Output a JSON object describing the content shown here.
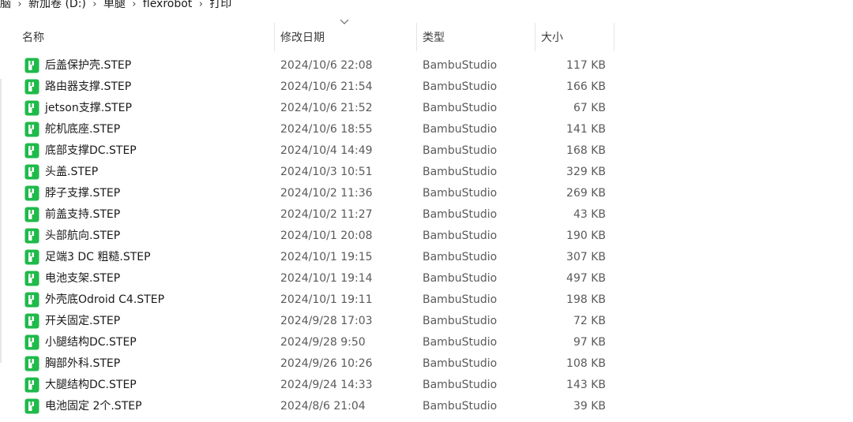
{
  "breadcrumb": {
    "segments": [
      "脑",
      "新加卷 (D:)",
      "单腿",
      "flexrobot",
      "打印"
    ],
    "separator": "›"
  },
  "columns": {
    "name": "名称",
    "modified": "修改日期",
    "type": "类型",
    "size": "大小"
  },
  "sort": {
    "column": "modified",
    "direction": "descending",
    "icon": "chevron-down-icon"
  },
  "file_icon": {
    "name": "bambu-step-file-icon",
    "color": "#1fba4a"
  },
  "files": [
    {
      "name": "后盖保护壳.STEP",
      "modified": "2024/10/6 22:08",
      "type": "BambuStudio",
      "size": "117 KB"
    },
    {
      "name": "路由器支撑.STEP",
      "modified": "2024/10/6 21:54",
      "type": "BambuStudio",
      "size": "166 KB"
    },
    {
      "name": "jetson支撑.STEP",
      "modified": "2024/10/6 21:52",
      "type": "BambuStudio",
      "size": "67 KB"
    },
    {
      "name": "舵机底座.STEP",
      "modified": "2024/10/6 18:55",
      "type": "BambuStudio",
      "size": "141 KB"
    },
    {
      "name": "底部支撑DC.STEP",
      "modified": "2024/10/4 14:49",
      "type": "BambuStudio",
      "size": "168 KB"
    },
    {
      "name": "头盖.STEP",
      "modified": "2024/10/3 10:51",
      "type": "BambuStudio",
      "size": "329 KB"
    },
    {
      "name": "脖子支撑.STEP",
      "modified": "2024/10/2 11:36",
      "type": "BambuStudio",
      "size": "269 KB"
    },
    {
      "name": "前盖支持.STEP",
      "modified": "2024/10/2 11:27",
      "type": "BambuStudio",
      "size": "43 KB"
    },
    {
      "name": "头部航向.STEP",
      "modified": "2024/10/1 20:08",
      "type": "BambuStudio",
      "size": "190 KB"
    },
    {
      "name": "足端3 DC 粗糙.STEP",
      "modified": "2024/10/1 19:15",
      "type": "BambuStudio",
      "size": "307 KB"
    },
    {
      "name": "电池支架.STEP",
      "modified": "2024/10/1 19:14",
      "type": "BambuStudio",
      "size": "497 KB"
    },
    {
      "name": "外壳底Odroid C4.STEP",
      "modified": "2024/10/1 19:11",
      "type": "BambuStudio",
      "size": "198 KB"
    },
    {
      "name": "开关固定.STEP",
      "modified": "2024/9/28 17:03",
      "type": "BambuStudio",
      "size": "72 KB"
    },
    {
      "name": "小腿结构DC.STEP",
      "modified": "2024/9/28 9:50",
      "type": "BambuStudio",
      "size": "97 KB"
    },
    {
      "name": "胸部外科.STEP",
      "modified": "2024/9/26 10:26",
      "type": "BambuStudio",
      "size": "108 KB"
    },
    {
      "name": "大腿结构DC.STEP",
      "modified": "2024/9/24 14:33",
      "type": "BambuStudio",
      "size": "143 KB"
    },
    {
      "name": "电池固定 2个.STEP",
      "modified": "2024/8/6 21:04",
      "type": "BambuStudio",
      "size": "39 KB"
    }
  ]
}
